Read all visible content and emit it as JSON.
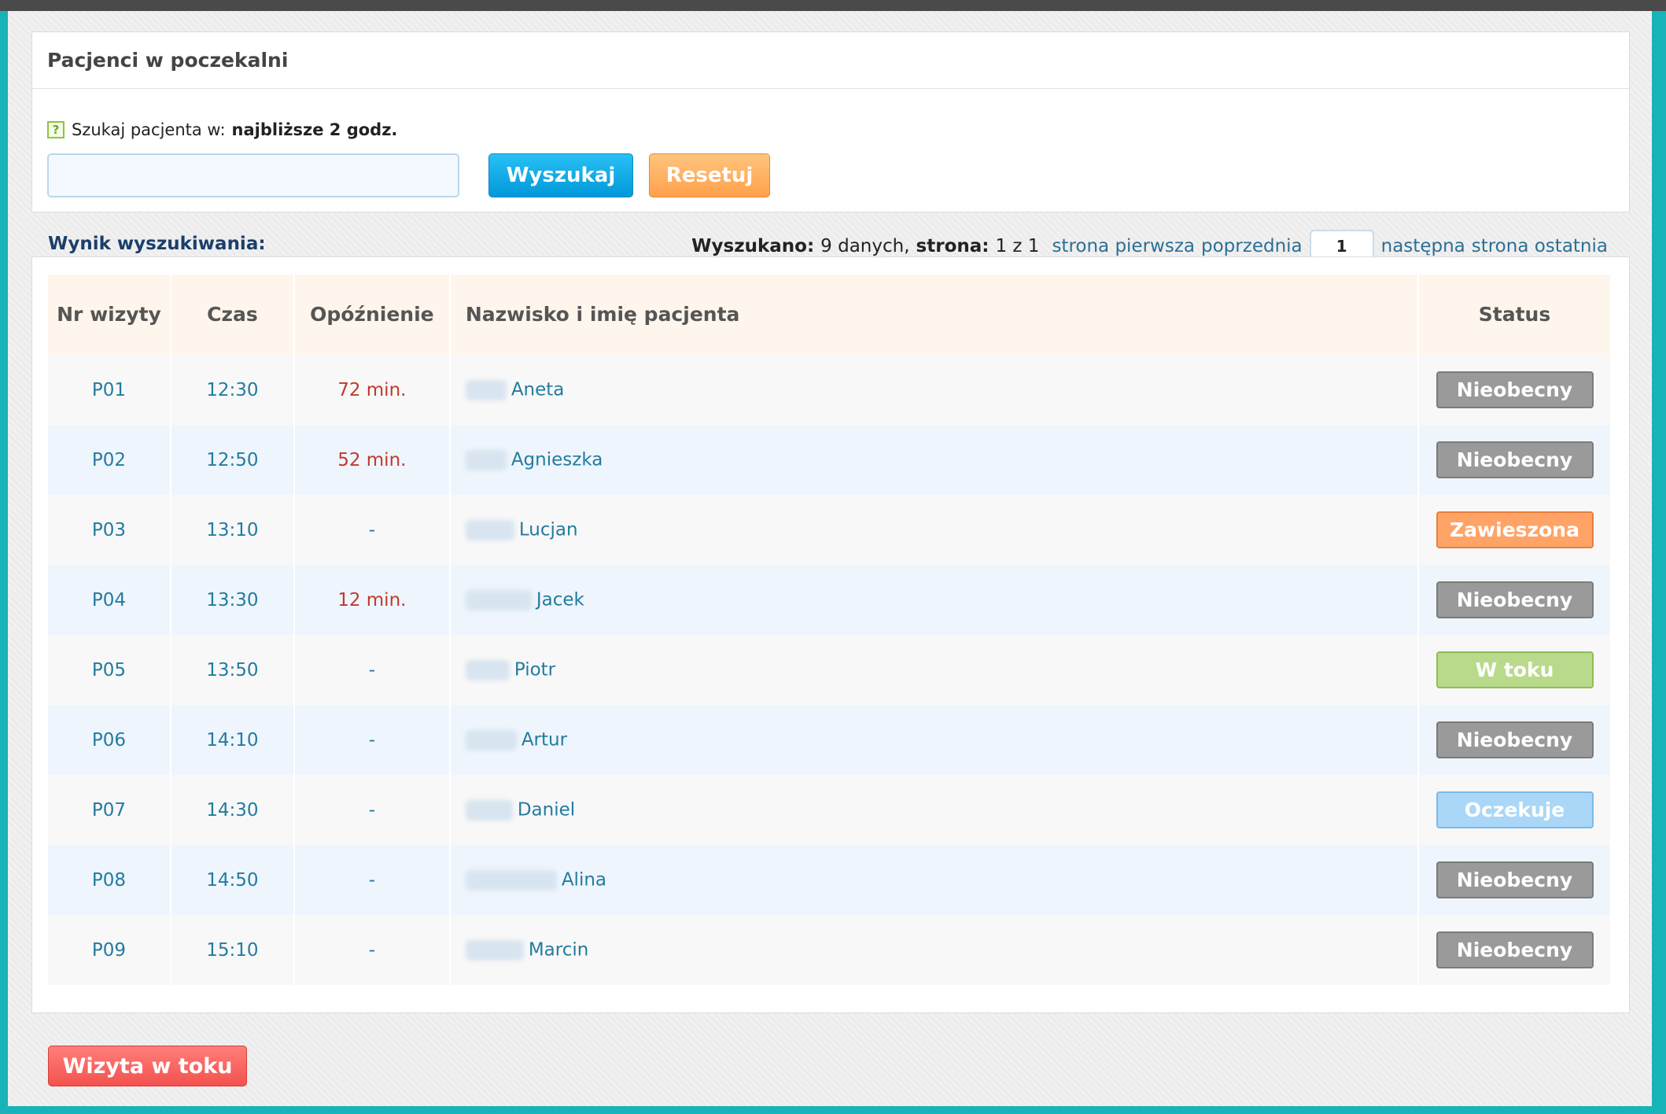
{
  "panel": {
    "title": "Pacjenci w poczekalni",
    "help_icon": "?",
    "search_label": "Szukaj pacjenta w:",
    "search_scope": "najbliższe 2 godz.",
    "search_value": "",
    "search_button": "Wyszukaj",
    "reset_button": "Resetuj"
  },
  "results": {
    "label": "Wynik wyszukiwania:",
    "found_label": "Wyszukano:",
    "found_value": "9 danych,",
    "page_label": "strona:",
    "page_value": "1 z 1",
    "links": [
      "strona pierwsza",
      "poprzednia",
      "następna",
      "strona ostatnia"
    ],
    "current_page": "1"
  },
  "table": {
    "headers": [
      "Nr wizyty",
      "Czas",
      "Opóźnienie",
      "Nazwisko i imię pacjenta",
      "Status"
    ],
    "rows": [
      {
        "nr": "P01",
        "time": "12:30",
        "delay": "72 min.",
        "first_name": "Aneta",
        "status": "Nieobecny"
      },
      {
        "nr": "P02",
        "time": "12:50",
        "delay": "52 min.",
        "first_name": "Agnieszka",
        "status": "Nieobecny"
      },
      {
        "nr": "P03",
        "time": "13:10",
        "delay": "-",
        "first_name": "Lucjan",
        "status": "Zawieszona"
      },
      {
        "nr": "P04",
        "time": "13:30",
        "delay": "12 min.",
        "first_name": "Jacek",
        "status": "Nieobecny"
      },
      {
        "nr": "P05",
        "time": "13:50",
        "delay": "-",
        "first_name": "Piotr",
        "status": "W toku"
      },
      {
        "nr": "P06",
        "time": "14:10",
        "delay": "-",
        "first_name": "Artur",
        "status": "Nieobecny"
      },
      {
        "nr": "P07",
        "time": "14:30",
        "delay": "-",
        "first_name": "Daniel",
        "status": "Oczekuje"
      },
      {
        "nr": "P08",
        "time": "14:50",
        "delay": "-",
        "first_name": "Alina",
        "status": "Nieobecny"
      },
      {
        "nr": "P09",
        "time": "15:10",
        "delay": "-",
        "first_name": "Marcin",
        "status": "Nieobecny"
      }
    ]
  },
  "footer": {
    "visit_button": "Wizyta w toku"
  },
  "colors": {
    "accent_blue": "#0098d9",
    "reset_orange": "#ffa04b",
    "status_absent": "#9a9a9a",
    "status_suspended": "#ffa466",
    "status_in_progress": "#b8da8a",
    "status_waiting": "#aad7f7",
    "visit_button": "#f4524e",
    "frame": "#17b3b8"
  }
}
